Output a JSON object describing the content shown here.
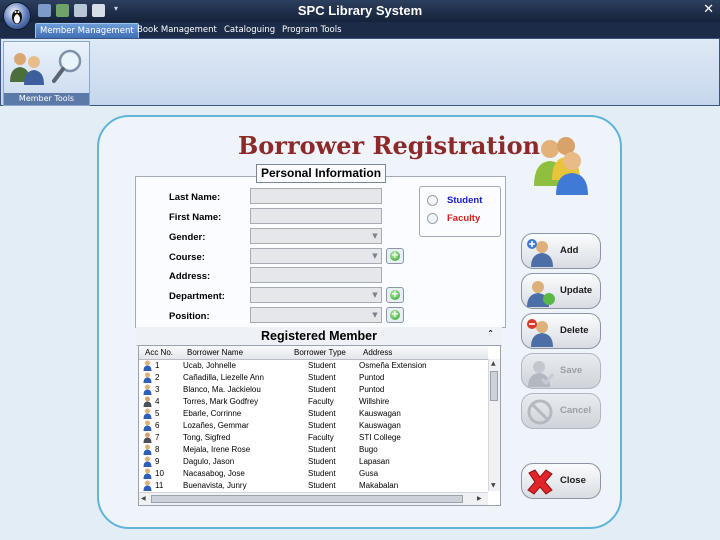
{
  "app": {
    "title": "SPC Library System"
  },
  "menu": {
    "tabs": [
      {
        "label": "Member Management",
        "active": true
      },
      {
        "label": "Book  Management",
        "active": false
      },
      {
        "label": "Cataloguing",
        "active": false
      },
      {
        "label": "Program Tools",
        "active": false
      }
    ]
  },
  "ribbon": {
    "group_label": "Member Tools"
  },
  "page": {
    "heading": "Borrower Registration"
  },
  "form": {
    "legend": "Personal Information",
    "labels": {
      "last_name": "Last Name:",
      "first_name": "First Name:",
      "gender": "Gender:",
      "course": "Course:",
      "address": "Address:",
      "department": "Department:",
      "position": "Position:"
    },
    "values": {
      "last_name": "",
      "first_name": "",
      "gender": "",
      "course": "",
      "address": "",
      "department": "",
      "position": ""
    },
    "borrower_type": {
      "student": {
        "label": "Student",
        "color": "#1a1ad2"
      },
      "faculty": {
        "label": "Faculty",
        "color": "#d22020"
      }
    }
  },
  "registered": {
    "title": "Registered Member",
    "columns": [
      "Acc No.",
      "Borrower Name",
      "Borrower Type",
      "Address"
    ],
    "rows": [
      {
        "acc": "1",
        "name": "Ucab, Johnelle",
        "type": "Student",
        "address": "Osmeña Extension"
      },
      {
        "acc": "2",
        "name": "Cañadilla, Liezelle Ann",
        "type": "Student",
        "address": "Puntod"
      },
      {
        "acc": "3",
        "name": "Blanco, Ma. Jackielou",
        "type": "Student",
        "address": "Puntod"
      },
      {
        "acc": "4",
        "name": "Torres, Mark Godfrey",
        "type": "Faculty",
        "address": "Willshire"
      },
      {
        "acc": "5",
        "name": "Ebarle, Corrinne",
        "type": "Student",
        "address": "Kauswagan"
      },
      {
        "acc": "6",
        "name": "Lozañes, Gemmar",
        "type": "Student",
        "address": "Kauswagan"
      },
      {
        "acc": "7",
        "name": "Tong, Sigfred",
        "type": "Faculty",
        "address": "STI College"
      },
      {
        "acc": "8",
        "name": "Mejala, Irene Rose",
        "type": "Student",
        "address": "Bugo"
      },
      {
        "acc": "9",
        "name": "Dagulo, Jason",
        "type": "Student",
        "address": "Lapasan"
      },
      {
        "acc": "10",
        "name": "Nacasabog, Jose",
        "type": "Student",
        "address": "Gusa"
      },
      {
        "acc": "11",
        "name": "Buenavista, Junry",
        "type": "Student",
        "address": "Makabalan"
      }
    ]
  },
  "actions": {
    "add": "Add",
    "update": "Update",
    "delete": "Delete",
    "save": "Save",
    "cancel": "Cancel",
    "close": "Close"
  },
  "colors": {
    "heading": "#8c2a2a",
    "accent": "#5fb4d8",
    "titlebar": "#1c2b47"
  }
}
